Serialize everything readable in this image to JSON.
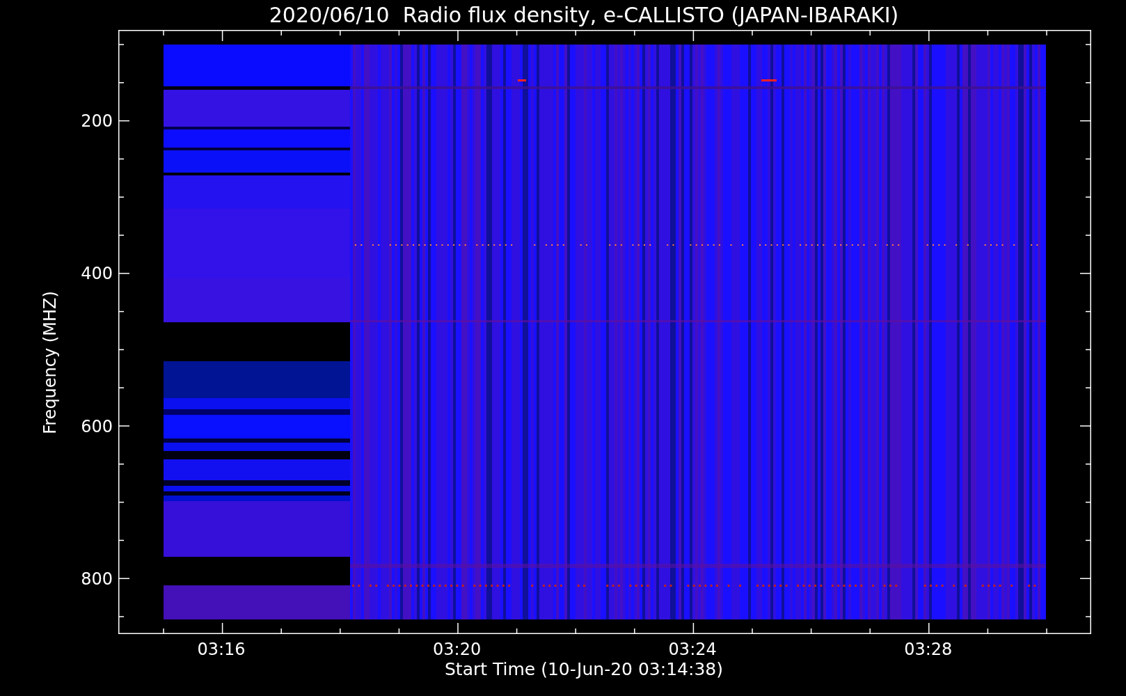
{
  "title": "2020/06/10  Radio flux density, e-CALLISTO (JAPAN-IBARAKI)",
  "plot": {
    "ylabel": "Frequency (MHZ)",
    "xlabel": "Start Time (10-Jun-20 03:14:38)",
    "yticks": [
      "200",
      "400",
      "600",
      "800"
    ],
    "xticks": [
      "03:16",
      "03:20",
      "03:24",
      "03:28"
    ]
  }
}
